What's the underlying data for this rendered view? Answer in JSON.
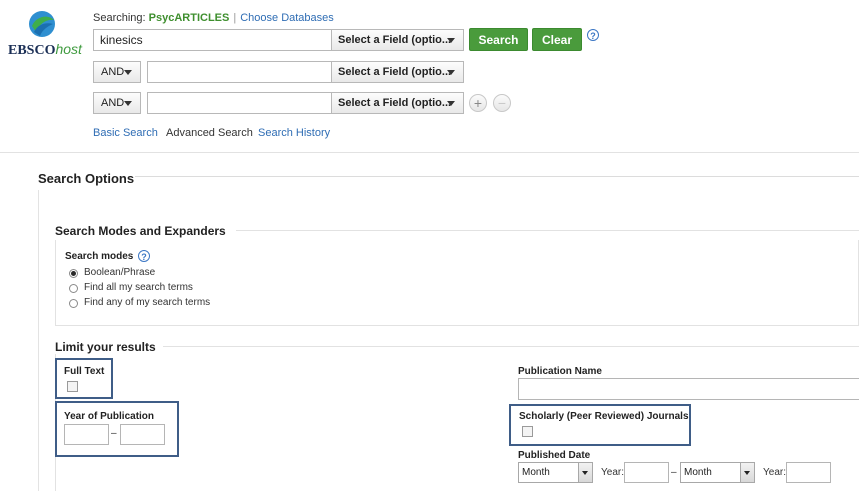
{
  "brand": {
    "logo_main": "EBSCO",
    "logo_suffix": "host"
  },
  "header": {
    "searching_label": "Searching:",
    "database": "PsycARTICLES",
    "choose_databases": "Choose Databases"
  },
  "search_rows": [
    {
      "value": "kinesics",
      "field": "Select a Field (optio..."
    },
    {
      "operator": "AND",
      "value": "",
      "field": "Select a Field (optio..."
    },
    {
      "operator": "AND",
      "value": "",
      "field": "Select a Field (optio..."
    }
  ],
  "buttons": {
    "search": "Search",
    "clear": "Clear",
    "help": "?",
    "add": "+",
    "remove": "−"
  },
  "nav": {
    "basic": "Basic Search",
    "advanced": "Advanced Search",
    "history": "Search History"
  },
  "options": {
    "title": "Search Options",
    "modes_section": "Search Modes and Expanders",
    "modes_label": "Search modes",
    "modes": [
      {
        "label": "Boolean/Phrase",
        "selected": true
      },
      {
        "label": "Find all my search terms",
        "selected": false
      },
      {
        "label": "Find any of my search terms",
        "selected": false
      }
    ]
  },
  "limits": {
    "title": "Limit your results",
    "full_text": "Full Text",
    "year_label": "Year of Publication",
    "year_dash": "–",
    "pub_name": "Publication Name",
    "scholarly": "Scholarly (Peer Reviewed) Journals",
    "pub_date": "Published Date",
    "month1": "Month",
    "year1_label": "Year:",
    "date_dash": "–",
    "month2": "Month",
    "year2_label": "Year:"
  },
  "colors": {
    "accent_green": "#4a9b3c",
    "link_blue": "#2f6db4",
    "highlight_border": "#3f5d87"
  }
}
